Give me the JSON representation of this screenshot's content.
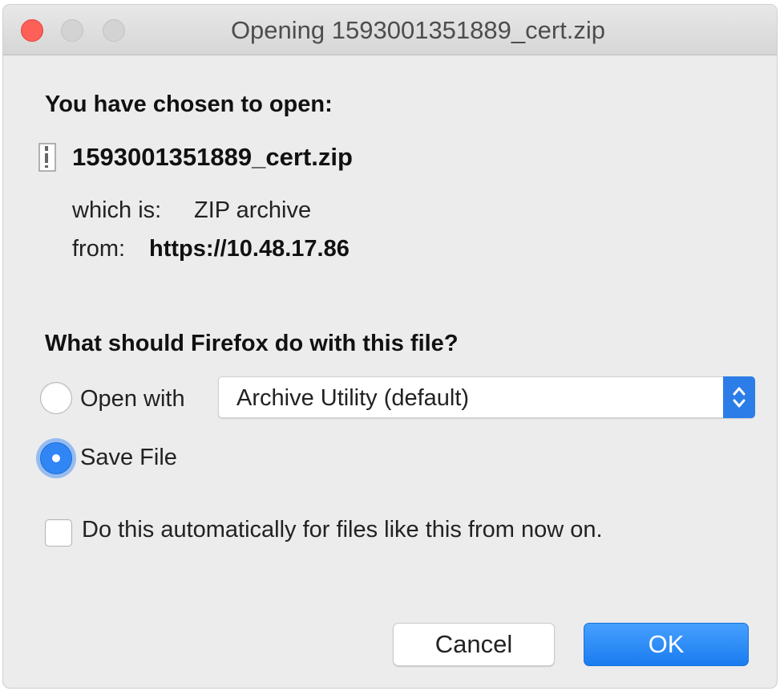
{
  "window": {
    "title": "Opening 1593001351889_cert.zip"
  },
  "dialog": {
    "intro_heading": "You have chosen to open:",
    "filename": "1593001351889_cert.zip",
    "type_label": "which is:",
    "type_value": "ZIP archive",
    "from_label": "from:",
    "from_value": "https://10.48.17.86",
    "question_heading": "What should Firefox do with this file?",
    "open_with_label": "Open with",
    "open_with_app": "Archive Utility (default)",
    "save_file_label": "Save File",
    "selected_option": "Save File",
    "auto_checkbox_label": "Do this automatically for files like this from now on.",
    "auto_checkbox_checked": false
  },
  "buttons": {
    "cancel": "Cancel",
    "ok": "OK"
  },
  "colors": {
    "accent": "#2f86f4",
    "close_button": "#fe5f57"
  },
  "icons": {
    "file": "document-file-icon",
    "select_arrows": "chevron-up-down-icon"
  }
}
